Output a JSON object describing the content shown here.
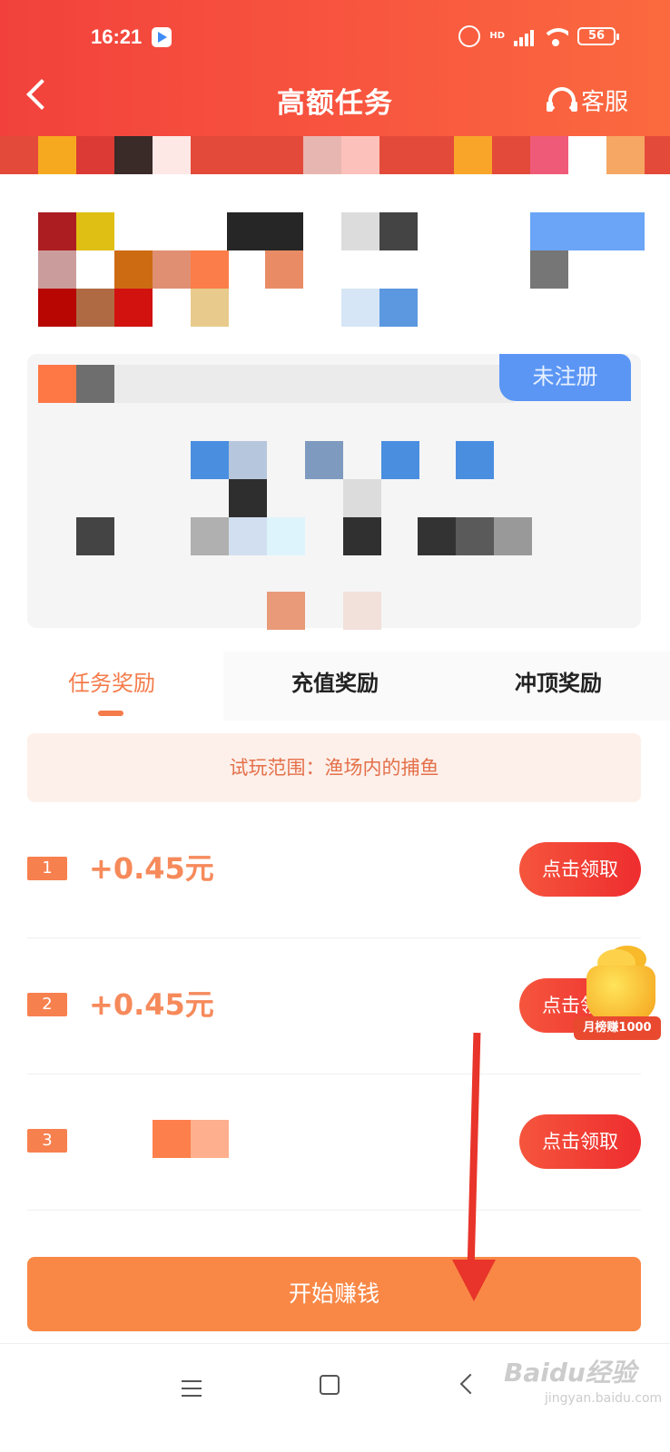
{
  "status_bar": {
    "time": "16:21",
    "network": "HD",
    "battery": "56"
  },
  "nav": {
    "title": "高额任务",
    "service_label": "客服"
  },
  "account": {
    "status_badge": "未注册"
  },
  "tabs": [
    {
      "label": "任务奖励",
      "active": true
    },
    {
      "label": "充值奖励",
      "active": false
    },
    {
      "label": "冲顶奖励",
      "active": false
    }
  ],
  "scope_notice": "试玩范围：渔场内的捕鱼",
  "tasks": [
    {
      "index": "1",
      "reward": "+0.45元",
      "action": "点击领取"
    },
    {
      "index": "2",
      "reward": "+0.45元",
      "action": "点击领取"
    },
    {
      "index": "3",
      "reward": "",
      "action": "点击领取"
    }
  ],
  "promo": {
    "label": "月榜赚1000"
  },
  "start_button": "开始赚钱",
  "watermark": {
    "brand": "Baidu经验",
    "url": "jingyan.baidu.com"
  },
  "colors": {
    "header": "#f2413c",
    "accent": "#f47b4a",
    "claim": "#ee2d2f",
    "start": "#f98847",
    "annotation": "#e8342a"
  }
}
